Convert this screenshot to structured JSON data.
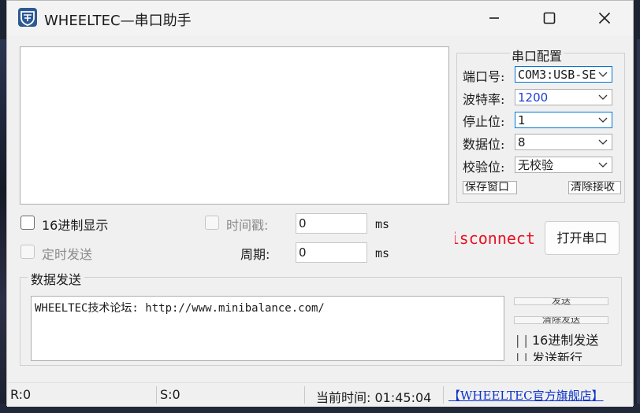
{
  "window": {
    "title": "WHEELTEC—串口助手"
  },
  "serial_config": {
    "title": "串口配置",
    "rows": [
      {
        "label": "端口号:",
        "value": "COM3:USB-SE"
      },
      {
        "label": "波特率:",
        "value": "1200"
      },
      {
        "label": "停止位:",
        "value": "1"
      },
      {
        "label": "数据位:",
        "value": "8"
      },
      {
        "label": "校验位:",
        "value": "无校验"
      }
    ],
    "save_window_label": "保存窗口",
    "clear_receive_label": "清除接收"
  },
  "options": {
    "hex_display_label": "16进制显示",
    "timestamp_label": "时间戳:",
    "timestamp_value": "0",
    "timed_send_label": "定时发送",
    "period_label": "周期:",
    "period_value": "0",
    "unit_ms": "ms"
  },
  "connection": {
    "status_text": "isconnect",
    "status_color": "#e81123",
    "open_port_label": "打开串口"
  },
  "send": {
    "title": "数据发送",
    "text": "WHEELTEC技术论坛:  http://www.minibalance.com/",
    "send_label": "发送",
    "clear_send_label": "清除发送",
    "hex_send_label": "16进制发送",
    "newline_label": "发送新行"
  },
  "statusbar": {
    "rx": "R:0",
    "tx": "S:0",
    "time_label": "当前时间: 01:45:04",
    "store_link": "【WHEELTEC官方旗舰店】"
  }
}
